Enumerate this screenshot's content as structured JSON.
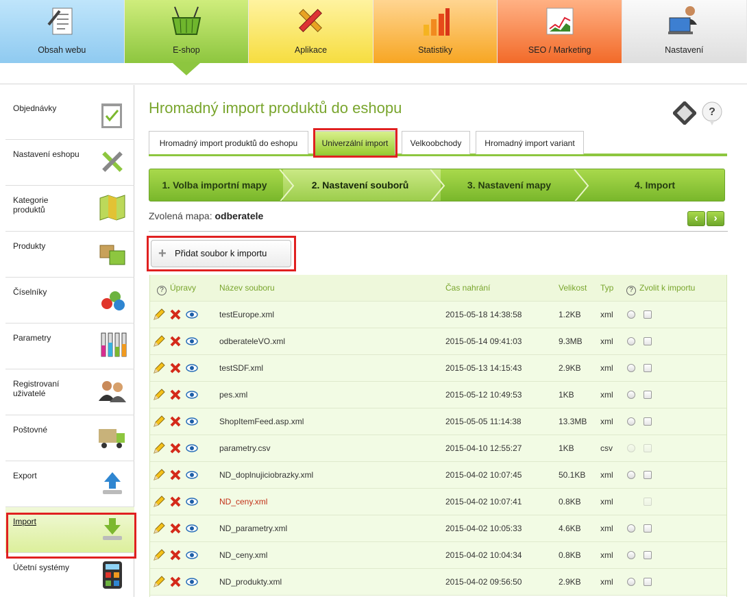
{
  "topnav": [
    {
      "label": "Obsah webu",
      "color": "#8fcaf0",
      "icon": "document-icon"
    },
    {
      "label": "E-shop",
      "color": "#8dc63f",
      "icon": "basket-icon"
    },
    {
      "label": "Aplikace",
      "color": "#f6dd3f",
      "icon": "tools-icon"
    },
    {
      "label": "Statistiky",
      "color": "#f7a623",
      "icon": "bar-chart-icon"
    },
    {
      "label": "SEO / Marketing",
      "color": "#f26a29",
      "icon": "line-chart-icon"
    },
    {
      "label": "Nastavení",
      "color": "#dedede",
      "icon": "admin-icon"
    }
  ],
  "sidebar": {
    "items": [
      {
        "label": "Objednávky",
        "icon": "clipboard-icon"
      },
      {
        "label": "Nastavení eshopu",
        "icon": "wrench-icon"
      },
      {
        "label": "Kategorie produktů",
        "icon": "map-icon"
      },
      {
        "label": "Produkty",
        "icon": "boxes-icon"
      },
      {
        "label": "Číselníky",
        "icon": "numbers-icon"
      },
      {
        "label": "Parametry",
        "icon": "tubes-icon"
      },
      {
        "label": "Registrovaní uživatelé",
        "icon": "users-icon"
      },
      {
        "label": "Poštovné",
        "icon": "truck-icon"
      },
      {
        "label": "Export",
        "icon": "upload-icon"
      },
      {
        "label": "Import",
        "icon": "download-icon",
        "active": true
      },
      {
        "label": "Účetní systémy",
        "icon": "calculator-icon"
      }
    ]
  },
  "main": {
    "title": "Hromadný import produktů do eshopu",
    "tabs": [
      {
        "label": "Hromadný import produktů do eshopu"
      },
      {
        "label": "Univerzální import",
        "active": true
      },
      {
        "label": "Velkoobchody"
      },
      {
        "label": "Hromadný import variant"
      }
    ],
    "steps": [
      {
        "label": "1. Volba importní mapy"
      },
      {
        "label": "2. Nastavení souborů",
        "active": true
      },
      {
        "label": "3. Nastavení mapy"
      },
      {
        "label": "4. Import"
      }
    ],
    "map_label": "Zvolená mapa:",
    "map_value": "odberatele",
    "add_button": "Přidat soubor k importu",
    "prev_arrow": "‹",
    "next_arrow": "›"
  },
  "table": {
    "headers": {
      "actions": "Úpravy",
      "name": "Název souboru",
      "time": "Čas nahrání",
      "size": "Velikost",
      "type": "Typ",
      "select": "Zvolit k importu"
    },
    "help_glyph": "?",
    "rows": [
      {
        "name": "testEurope.xml",
        "time": "2015-05-18 14:38:58",
        "size": "1.2KB",
        "type": "xml"
      },
      {
        "name": "odberateleVO.xml",
        "time": "2015-05-14 09:41:03",
        "size": "9.3MB",
        "type": "xml"
      },
      {
        "name": "testSDF.xml",
        "time": "2015-05-13 14:15:43",
        "size": "2.9KB",
        "type": "xml"
      },
      {
        "name": "pes.xml",
        "time": "2015-05-12 10:49:53",
        "size": "1KB",
        "type": "xml"
      },
      {
        "name": "ShopItemFeed.asp.xml",
        "time": "2015-05-05 11:14:38",
        "size": "13.3MB",
        "type": "xml"
      },
      {
        "name": "parametry.csv",
        "time": "2015-04-10 12:55:27",
        "size": "1KB",
        "type": "csv",
        "disabled": true
      },
      {
        "name": "ND_doplnujiciobrazky.xml",
        "time": "2015-04-02 10:07:45",
        "size": "50.1KB",
        "type": "xml"
      },
      {
        "name": "ND_ceny.xml",
        "time": "2015-04-02 10:07:41",
        "size": "0.8KB",
        "type": "xml",
        "error": true,
        "disabled": true
      },
      {
        "name": "ND_parametry.xml",
        "time": "2015-04-02 10:05:33",
        "size": "4.6KB",
        "type": "xml"
      },
      {
        "name": "ND_ceny.xml",
        "time": "2015-04-02 10:04:34",
        "size": "0.8KB",
        "type": "xml"
      },
      {
        "name": "ND_produkty.xml",
        "time": "2015-04-02 09:56:50",
        "size": "2.9KB",
        "type": "xml"
      }
    ]
  }
}
